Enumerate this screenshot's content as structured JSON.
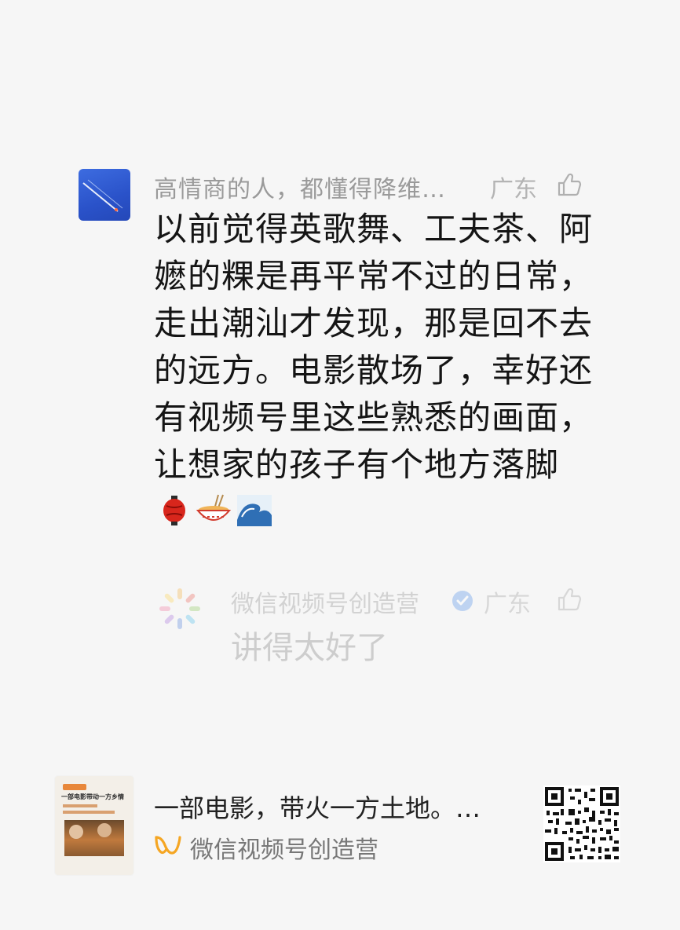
{
  "comment": {
    "author": "高情商的人，都懂得降维…",
    "location": "广东",
    "avatar_icon": "blue-avatar-image",
    "like_icon": "thumbs-up-outline-icon",
    "text": "以前觉得英歌舞、工夫茶、阿嬷的粿是再平常不过的日常，走出潮汕才发现，那是回不去的远方。电影散场了，幸好还有视频号里这些熟悉的画面，让想家的孩子有个地方落脚",
    "emojis": [
      "lantern-emoji",
      "noodle-bowl-emoji",
      "wave-emoji"
    ]
  },
  "reply": {
    "author": "微信视频号创造营",
    "verified_icon": "verified-badge-icon",
    "location": "广东",
    "text": "讲得太好了"
  },
  "card": {
    "title": "一部电影，带火一方土地。…",
    "thumb_title": "一部电影带动一方乡情",
    "source_icon": "wechat-channels-icon",
    "source_name": "微信视频号创造营",
    "qr_icon": "qr-code-image"
  },
  "colors": {
    "background": "#f6f6f6",
    "accent": "#f5a623"
  }
}
